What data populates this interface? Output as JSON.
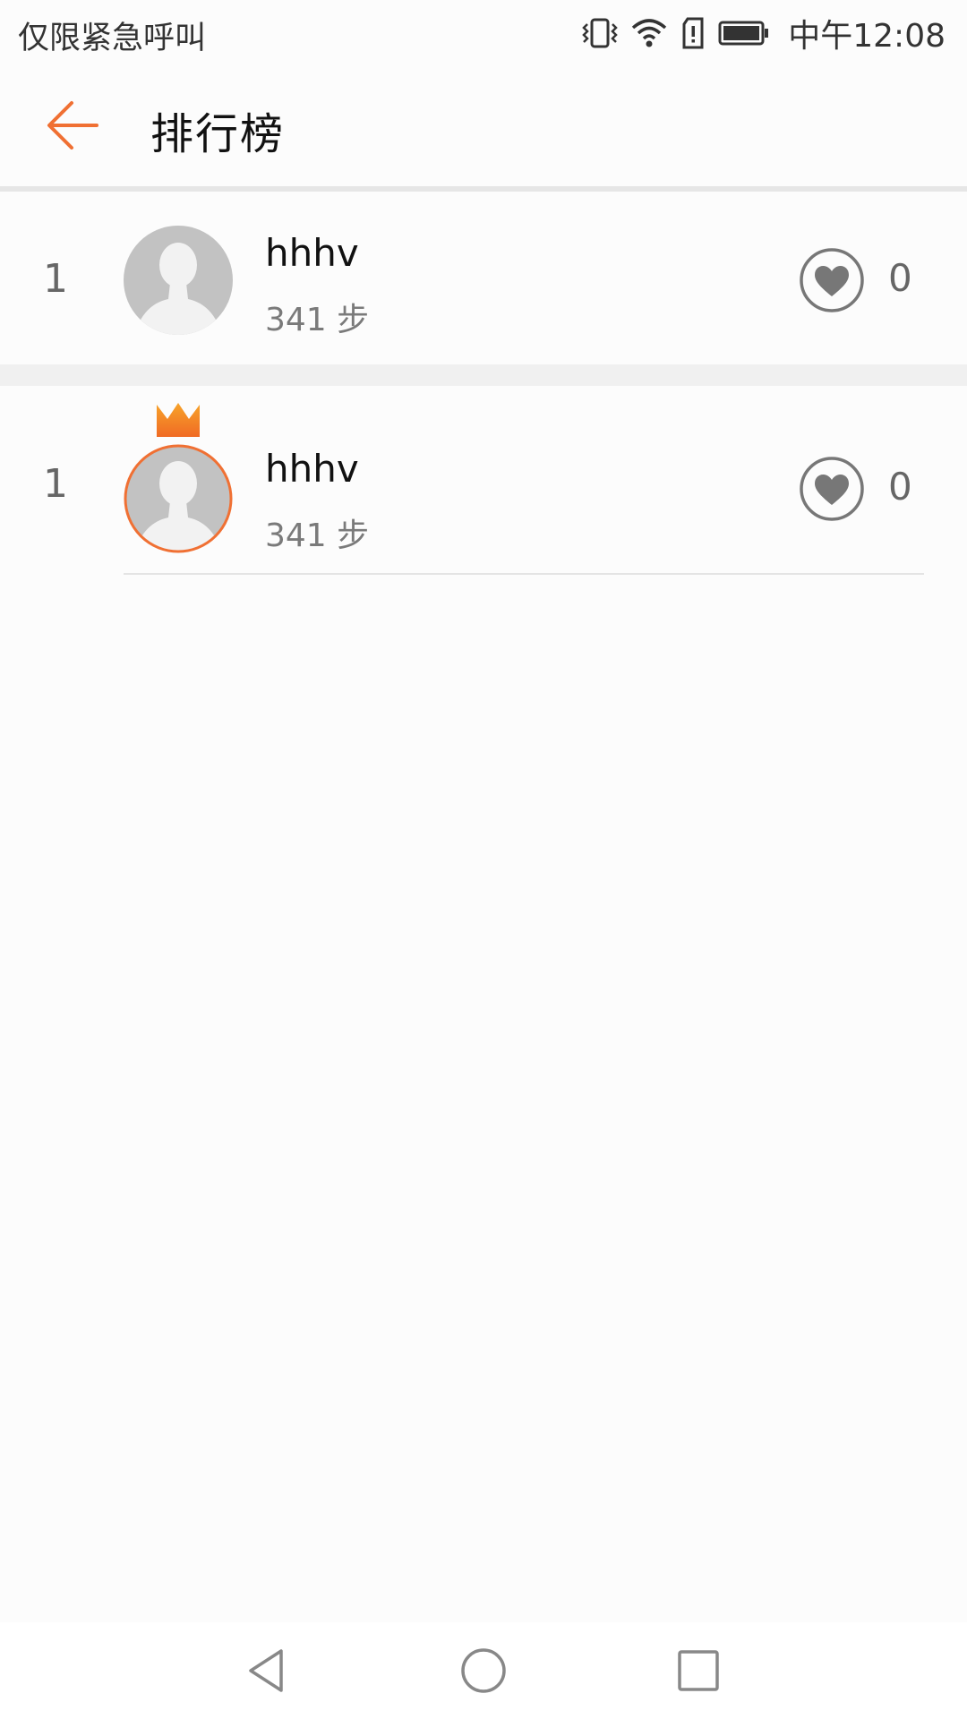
{
  "status_bar": {
    "left_text": "仅限紧急呼叫",
    "time": "中午12:08",
    "icons": [
      "vibrate-icon",
      "wifi-icon",
      "sim-alert-icon",
      "battery-icon"
    ]
  },
  "header": {
    "title": "排行榜",
    "back_icon": "arrow-left-icon"
  },
  "colors": {
    "accent": "#f07033",
    "crown_top": "#f7a42a",
    "crown_bottom": "#f06a24",
    "avatar_bg": "#c2c2c2",
    "heart": "#777777"
  },
  "my_rank": {
    "rank": "1",
    "name": "hhhv",
    "steps": "341 步",
    "likes": "0"
  },
  "leaderboard": [
    {
      "rank": "1",
      "name": "hhhv",
      "steps": "341 步",
      "likes": "0",
      "crown": true
    }
  ],
  "nav_bar": {
    "icons": [
      "back-triangle-icon",
      "home-circle-icon",
      "recents-square-icon"
    ]
  }
}
